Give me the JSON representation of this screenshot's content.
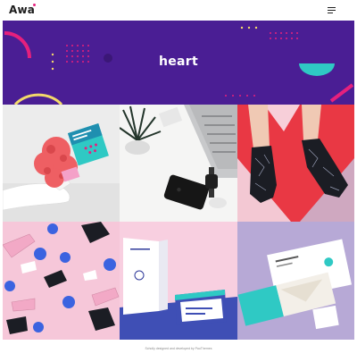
{
  "header": {
    "logo": "Awa"
  },
  "hero": {
    "title": "heart"
  },
  "footer": {
    "credit": "Scholly designed and developed by PaoThemes"
  },
  "colors": {
    "hero_bg": "#4a1e94",
    "accent_pink": "#e6207d",
    "accent_teal": "#2fc9c4",
    "accent_yellow": "#f3d96a"
  },
  "icons": {
    "menu": "hamburger-menu-icon"
  },
  "portfolio": [
    {
      "name": "sculpture-tile"
    },
    {
      "name": "desk-tile"
    },
    {
      "name": "socks-red-tile"
    },
    {
      "name": "socks-pink-tile"
    },
    {
      "name": "book-tile"
    },
    {
      "name": "cards-tile"
    }
  ]
}
